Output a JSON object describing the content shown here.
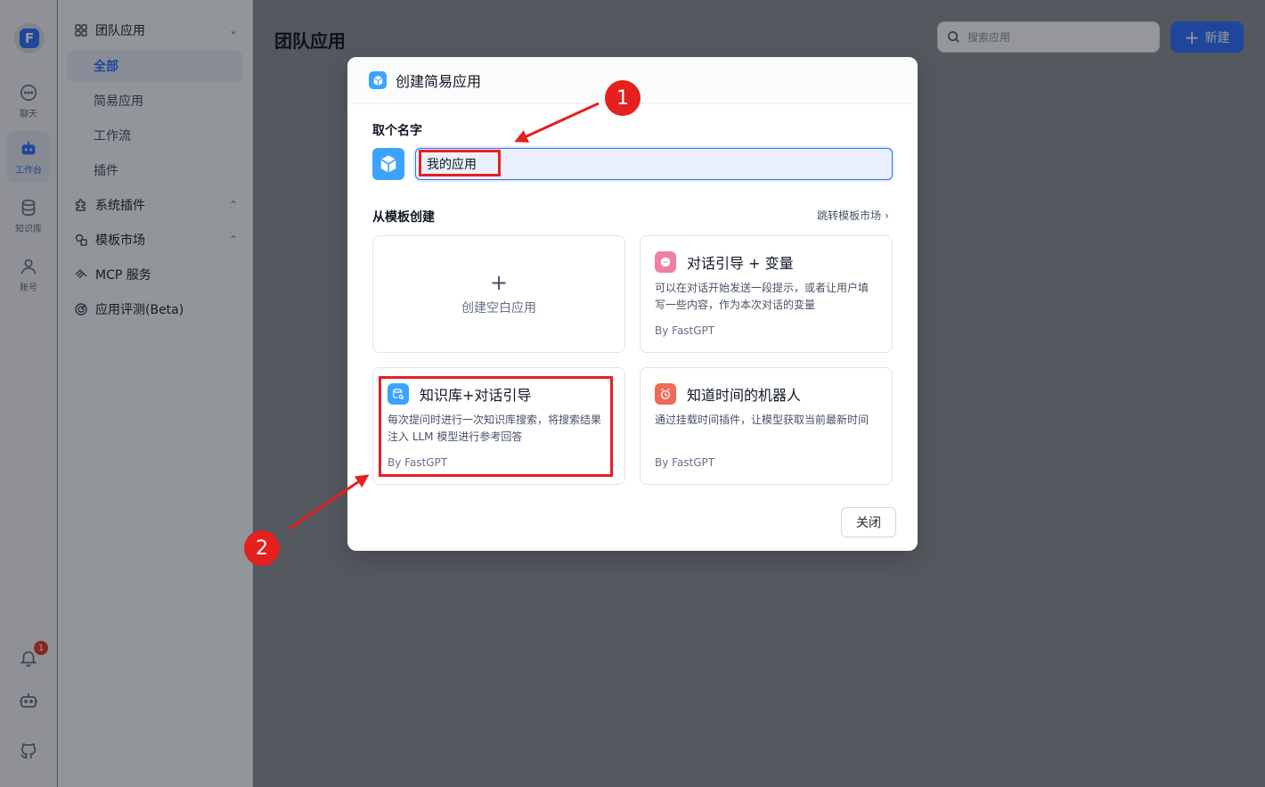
{
  "rail": {
    "items": [
      {
        "label": "聊天",
        "icon": "chat-icon"
      },
      {
        "label": "工作台",
        "icon": "robot-icon",
        "active": true
      },
      {
        "label": "知识库",
        "icon": "database-icon"
      },
      {
        "label": "账号",
        "icon": "user-icon"
      }
    ],
    "notification_count": "1"
  },
  "sidebar": {
    "team_apps": "团队应用",
    "sub_items": [
      "全部",
      "简易应用",
      "工作流",
      "插件"
    ],
    "system_plugins": "系统插件",
    "template_market": "模板市场",
    "mcp_service": "MCP 服务",
    "app_eval": "应用评测(Beta)"
  },
  "main": {
    "title": "团队应用",
    "search_placeholder": "搜索应用",
    "new_label": "新建"
  },
  "modal": {
    "title": "创建简易应用",
    "name_label": "取个名字",
    "name_value": "我的应用",
    "template_label": "从模板创建",
    "jump_link": "跳转模板市场",
    "blank_card": "创建空白应用",
    "cards": [
      {
        "title": "对话引导 + 变量",
        "desc": "可以在对话开始发送一段提示，或者让用户填写一些内容，作为本次对话的变量",
        "by": "By FastGPT",
        "icon_color": "#f07fa4"
      },
      {
        "title": "知识库+对话引导",
        "desc": "每次提问时进行一次知识库搜索，将搜索结果注入 LLM 模型进行参考回答",
        "by": "By FastGPT",
        "icon_color": "#3ba3ff"
      },
      {
        "title": "知道时间的机器人",
        "desc": "通过挂载时间插件，让模型获取当前最新时间",
        "by": "By FastGPT",
        "icon_color": "#f06a5a"
      }
    ],
    "close_label": "关闭"
  },
  "annotations": {
    "step1": "1",
    "step2": "2",
    "color": "#e5201e"
  }
}
